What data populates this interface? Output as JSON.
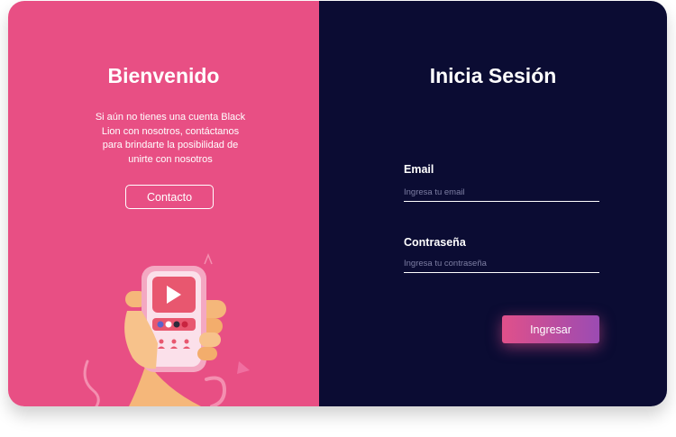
{
  "colors": {
    "left_panel": "#e84f84",
    "right_panel": "#0b0c33",
    "button_gradient_start": "#e0508a",
    "button_gradient_end": "#9b4bb3"
  },
  "welcome": {
    "title": "Bienvenido",
    "text": "Si aún no tienes una cuenta Black Lion con nosotros, contáctanos para brindarte la posibilidad de unirte con nosotros",
    "contact_label": "Contacto",
    "illustration": "hand-holding-phone-with-play-icon"
  },
  "login": {
    "title": "Inicia Sesión",
    "email_label": "Email",
    "email_placeholder": "Ingresa tu email",
    "email_value": "",
    "password_label": "Contraseña",
    "password_placeholder": "Ingresa tu contraseña",
    "password_value": "",
    "submit_label": "Ingresar"
  }
}
